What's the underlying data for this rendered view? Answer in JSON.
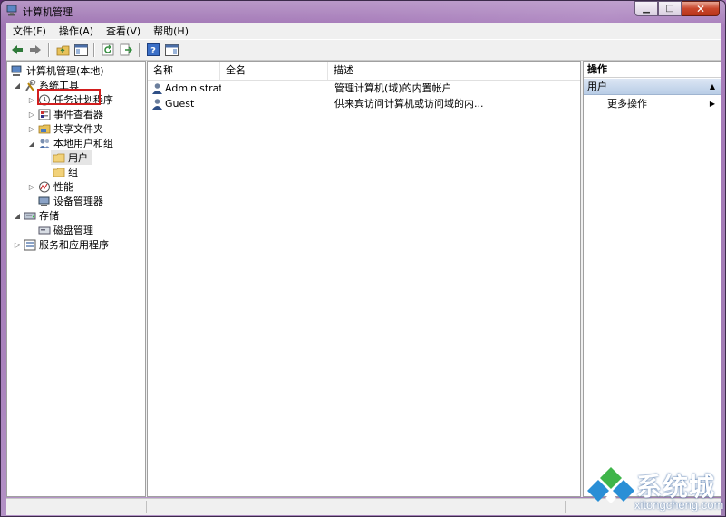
{
  "window": {
    "title": "计算机管理"
  },
  "menu": [
    "文件(F)",
    "操作(A)",
    "查看(V)",
    "帮助(H)"
  ],
  "toolbar": [
    "back-icon",
    "forward-icon",
    "up-icon",
    "show-hide-tree-icon",
    "refresh-icon",
    "export-icon",
    "help-icon",
    "properties-icon"
  ],
  "tree": {
    "root": "计算机管理(本地)",
    "system_tools": "系统工具",
    "task_scheduler": "任务计划程序",
    "event_viewer": "事件查看器",
    "shared_folders": "共享文件夹",
    "local_users": "本地用户和组",
    "users": "用户",
    "groups": "组",
    "performance": "性能",
    "device_manager": "设备管理器",
    "storage": "存储",
    "disk_management": "磁盘管理",
    "services": "服务和应用程序"
  },
  "list": {
    "columns": [
      "名称",
      "全名",
      "描述"
    ],
    "rows": [
      {
        "name": "Administrat...",
        "fullname": "",
        "description": "管理计算机(域)的内置帐户"
      },
      {
        "name": "Guest",
        "fullname": "",
        "description": "供来宾访问计算机或访问域的内..."
      }
    ]
  },
  "actions": {
    "header": "操作",
    "section": "用户",
    "more": "更多操作"
  },
  "watermark": {
    "text": "系统城",
    "url": "xitongcheng.com"
  },
  "colors": {
    "highlight": "#d21e1e",
    "section_bg": "#b9cde6"
  }
}
